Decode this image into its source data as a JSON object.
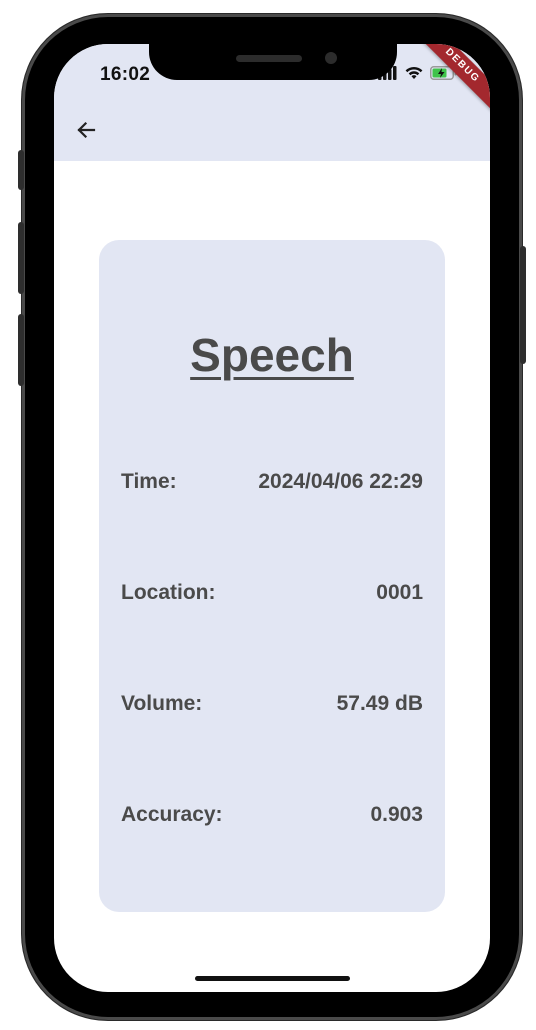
{
  "status_bar": {
    "time": "16:02",
    "debug_label": "DEBUG",
    "icons": [
      "signal-icon",
      "wifi-icon",
      "battery-charging-icon"
    ]
  },
  "header": {
    "back_icon": "arrow-left-icon"
  },
  "card": {
    "title": "Speech",
    "rows": [
      {
        "label": "Time:",
        "value": "2024/04/06 22:29"
      },
      {
        "label": "Location:",
        "value": "0001"
      },
      {
        "label": "Volume:",
        "value": "57.49 dB"
      },
      {
        "label": "Accuracy:",
        "value": "0.903"
      }
    ]
  },
  "colors": {
    "header_bg": "#e2e6f3",
    "card_bg": "#e2e6f3",
    "text": "#4a4a4a",
    "debug_ribbon": "#a3282e",
    "battery_green": "#3fc34a"
  }
}
